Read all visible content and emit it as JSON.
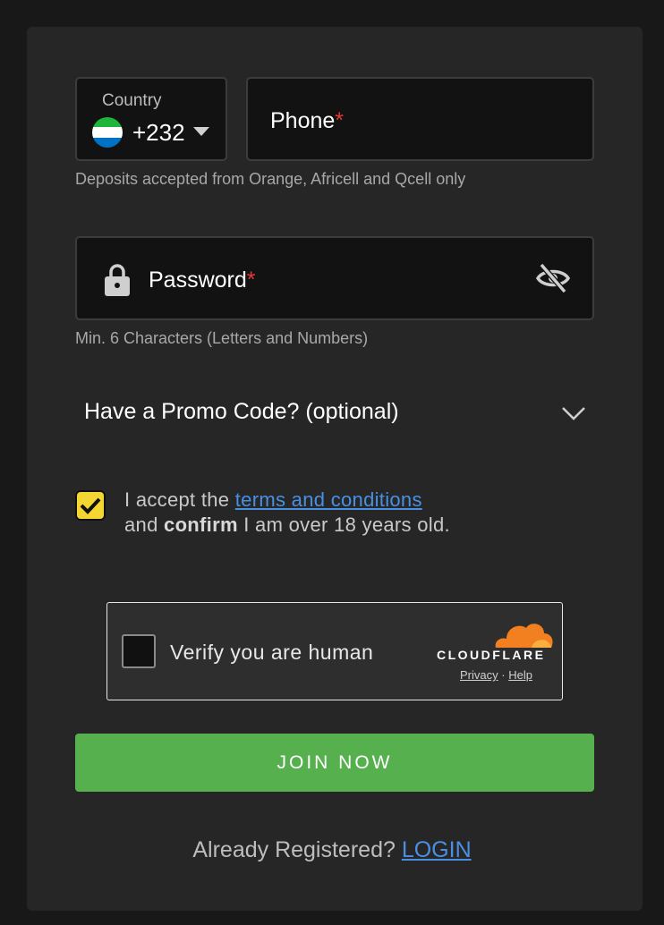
{
  "phone": {
    "country_label": "Country",
    "dial_code": "+232",
    "flag_colors": [
      "#1eb53a",
      "#ffffff",
      "#0072c6"
    ],
    "label": "Phone",
    "required_mark": "*",
    "helper": "Deposits accepted from Orange, Africell and Qcell only"
  },
  "password": {
    "label": "Password",
    "required_mark": "*",
    "helper": "Min. 6 Characters (Letters and Numbers)",
    "icon_lock": "lock-icon",
    "icon_toggle": "eye-off-icon"
  },
  "promo": {
    "label": "Have a Promo Code? (optional)",
    "icon": "chevron-down-icon"
  },
  "terms": {
    "checked": true,
    "prefix": "I accept the ",
    "link": "terms and conditions",
    "line2_pre": "and ",
    "line2_bold": "confirm",
    "line2_post": " I am over 18 years old."
  },
  "captcha": {
    "text": "Verify you are human",
    "brand": "CLOUDFLARE",
    "privacy": "Privacy",
    "separator": "·",
    "help": "Help"
  },
  "join_button": "JOIN NOW",
  "login": {
    "prompt": "Already Registered? ",
    "link": "LOGIN"
  },
  "colors": {
    "accent_green": "#55b04d",
    "link_blue": "#4a90e2",
    "required_red": "#e53935",
    "checkbox_yellow": "#f3d631",
    "cloudflare_orange": "#f38020"
  }
}
